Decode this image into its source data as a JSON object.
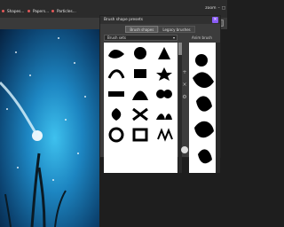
{
  "tabs": [
    {
      "label": "Shapes…",
      "dot": "#e45959"
    },
    {
      "label": "Papers…",
      "dot": "#e45959"
    },
    {
      "label": "Particles…",
      "dot": "#e45959"
    }
  ],
  "top_right": {
    "zoom_label": "zoom"
  },
  "panel": {
    "title": "Brush shape presets",
    "close": "×",
    "segments": [
      "Brush shapes",
      "Legacy brushes"
    ],
    "dropdown_value": "Brush sets",
    "preview_label": "Anim brush"
  },
  "icons": {
    "panel_close": "close-icon",
    "dropdown_caret": "chevron-down-icon",
    "side_add": "add-icon",
    "side_remove": "remove-icon",
    "side_settings": "settings-icon"
  },
  "colors": {
    "accent": "#8a5cf6"
  }
}
